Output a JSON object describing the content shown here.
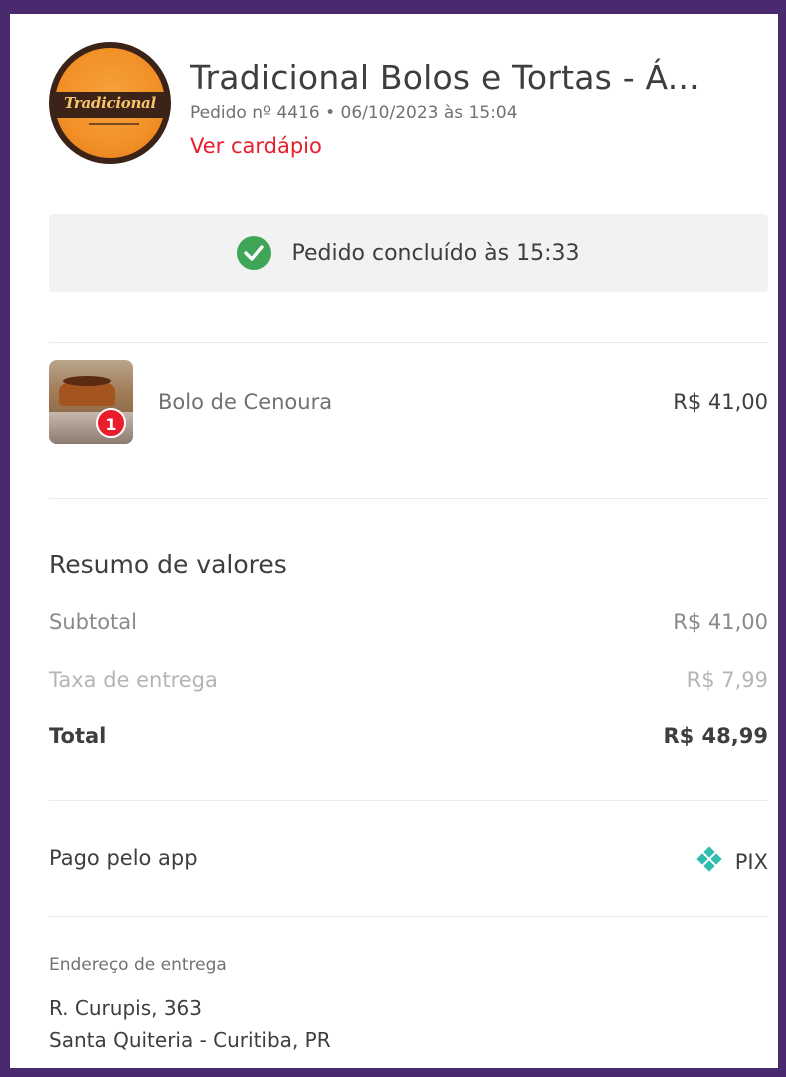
{
  "store": {
    "name": "Tradicional Bolos e Tortas - Á...",
    "logo_text": "Tradicional",
    "order_meta": "Pedido nº 4416 • 06/10/2023 às 15:04",
    "menu_link": "Ver cardápio"
  },
  "status": {
    "text": "Pedido concluído às 15:33",
    "icon": "check-circle-icon",
    "color": "#3fa657"
  },
  "items": [
    {
      "name": "Bolo de Cenoura",
      "price": "R$ 41,00",
      "quantity": "1"
    }
  ],
  "summary": {
    "title": "Resumo de valores",
    "subtotal_label": "Subtotal",
    "subtotal_value": "R$ 41,00",
    "fee_label": "Taxa de entrega",
    "fee_value": "R$ 7,99",
    "total_label": "Total",
    "total_value": "R$ 48,99"
  },
  "payment": {
    "label": "Pago pelo app",
    "method": "PIX",
    "icon": "pix-icon"
  },
  "address": {
    "title": "Endereço de entrega",
    "line1": "R. Curupis, 363",
    "line2": "Santa Quiteria - Curitiba, PR"
  },
  "colors": {
    "accent": "#ea1d2c",
    "success": "#3fa657",
    "pix": "#32bcad",
    "frame": "#4a2a6e"
  }
}
